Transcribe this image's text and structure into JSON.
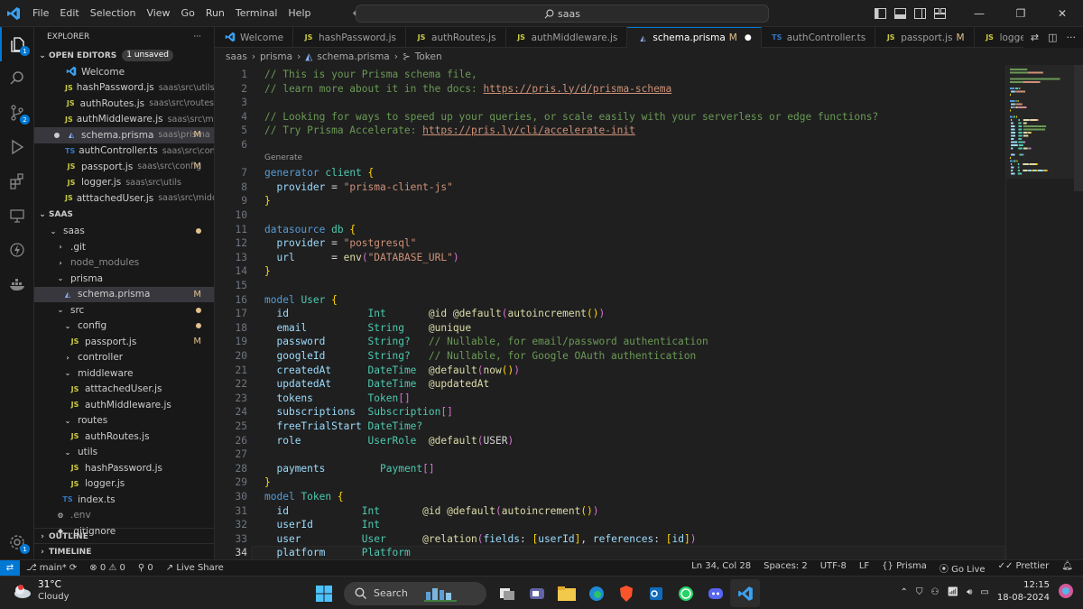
{
  "menu": [
    "File",
    "Edit",
    "Selection",
    "View",
    "Go",
    "Run",
    "Terminal",
    "Help"
  ],
  "search": {
    "label": "saas"
  },
  "activity_badges": {
    "explorer": "1",
    "scm": "2"
  },
  "sidebar": {
    "title": "EXPLORER",
    "open_editors": {
      "label": "OPEN EDITORS",
      "badge": "1 unsaved",
      "items": [
        {
          "icon": "vscode",
          "name": "Welcome",
          "path": "",
          "mark": ""
        },
        {
          "icon": "JS",
          "name": "hashPassword.js",
          "path": "saas\\src\\utils",
          "mark": ""
        },
        {
          "icon": "JS",
          "name": "authRoutes.js",
          "path": "saas\\src\\routes",
          "mark": ""
        },
        {
          "icon": "JS",
          "name": "authMiddleware.js",
          "path": "saas\\src\\midd...",
          "mark": ""
        },
        {
          "icon": "prisma",
          "name": "schema.prisma",
          "path": "saas\\prisma",
          "mark": "M"
        },
        {
          "icon": "TS",
          "name": "authController.ts",
          "path": "saas\\src\\contro...",
          "mark": ""
        },
        {
          "icon": "JS",
          "name": "passport.js",
          "path": "saas\\src\\config",
          "mark": "M"
        },
        {
          "icon": "JS",
          "name": "logger.js",
          "path": "saas\\src\\utils",
          "mark": ""
        },
        {
          "icon": "JS",
          "name": "atttachedUser.js",
          "path": "saas\\src\\middle...",
          "mark": ""
        }
      ]
    },
    "project": {
      "label": "SAAS",
      "tree": [
        {
          "type": "folder",
          "name": "saas",
          "depth": 1,
          "open": true,
          "dot": true
        },
        {
          "type": "folder",
          "name": ".git",
          "depth": 2,
          "open": false
        },
        {
          "type": "folder",
          "name": "node_modules",
          "depth": 2,
          "open": false,
          "dim": true
        },
        {
          "type": "folder",
          "name": "prisma",
          "depth": 2,
          "open": true
        },
        {
          "type": "prisma",
          "name": "schema.prisma",
          "depth": 3,
          "mark": "M",
          "selected": true
        },
        {
          "type": "folder",
          "name": "src",
          "depth": 2,
          "open": true,
          "dot": true
        },
        {
          "type": "folder",
          "name": "config",
          "depth": 3,
          "open": true,
          "dot": true
        },
        {
          "type": "JS",
          "name": "passport.js",
          "depth": 4,
          "mark": "M"
        },
        {
          "type": "folder",
          "name": "controller",
          "depth": 3,
          "open": false
        },
        {
          "type": "folder",
          "name": "middleware",
          "depth": 3,
          "open": true
        },
        {
          "type": "JS",
          "name": "atttachedUser.js",
          "depth": 4
        },
        {
          "type": "JS",
          "name": "authMiddleware.js",
          "depth": 4
        },
        {
          "type": "folder",
          "name": "routes",
          "depth": 3,
          "open": true
        },
        {
          "type": "JS",
          "name": "authRoutes.js",
          "depth": 4
        },
        {
          "type": "folder",
          "name": "utils",
          "depth": 3,
          "open": true
        },
        {
          "type": "JS",
          "name": "hashPassword.js",
          "depth": 4
        },
        {
          "type": "JS",
          "name": "logger.js",
          "depth": 4
        },
        {
          "type": "TS",
          "name": "index.ts",
          "depth": 3
        },
        {
          "type": "gear",
          "name": ".env",
          "depth": 2,
          "dim": true
        },
        {
          "type": "git",
          "name": ".gitignore",
          "depth": 2
        }
      ]
    },
    "outline": "OUTLINE",
    "timeline": "TIMELINE"
  },
  "tabs": [
    {
      "icon": "vscode",
      "label": "Welcome",
      "mark": ""
    },
    {
      "icon": "JS",
      "label": "hashPassword.js",
      "mark": ""
    },
    {
      "icon": "JS",
      "label": "authRoutes.js",
      "mark": ""
    },
    {
      "icon": "JS",
      "label": "authMiddleware.js",
      "mark": ""
    },
    {
      "icon": "prisma",
      "label": "schema.prisma",
      "mark": "M",
      "active": true,
      "dirty": true
    },
    {
      "icon": "TS",
      "label": "authController.ts",
      "mark": ""
    },
    {
      "icon": "JS",
      "label": "passport.js",
      "mark": "M"
    },
    {
      "icon": "JS",
      "label": "logger.js",
      "mark": ""
    }
  ],
  "breadcrumbs": [
    "saas",
    "prisma",
    "schema.prisma",
    "Token"
  ],
  "codelens": "Generate",
  "code": [
    {
      "n": 1,
      "t": [
        [
          "c-com",
          "// This is your Prisma schema file,"
        ]
      ]
    },
    {
      "n": 2,
      "t": [
        [
          "c-com",
          "// learn more about it in the docs: "
        ],
        [
          "c-link",
          "https://pris.ly/d/prisma-schema"
        ]
      ]
    },
    {
      "n": 3,
      "t": []
    },
    {
      "n": 4,
      "t": [
        [
          "c-com",
          "// Looking for ways to speed up your queries, or scale easily with your serverless or edge functions?"
        ]
      ]
    },
    {
      "n": 5,
      "t": [
        [
          "c-com",
          "// Try Prisma Accelerate: "
        ],
        [
          "c-link",
          "https://pris.ly/cli/accelerate-init"
        ]
      ]
    },
    {
      "n": 6,
      "t": []
    },
    {
      "n": 7,
      "t": [
        [
          "c-kw",
          "generator"
        ],
        [
          "c-w",
          " "
        ],
        [
          "c-id",
          "client"
        ],
        [
          "c-w",
          " "
        ],
        [
          "c-br",
          "{"
        ]
      ]
    },
    {
      "n": 8,
      "t": [
        [
          "c-w",
          "  "
        ],
        [
          "c-fld",
          "provider"
        ],
        [
          "c-w",
          " = "
        ],
        [
          "c-str",
          "\"prisma-client-js\""
        ]
      ]
    },
    {
      "n": 9,
      "t": [
        [
          "c-br",
          "}"
        ]
      ]
    },
    {
      "n": 10,
      "t": []
    },
    {
      "n": 11,
      "t": [
        [
          "c-kw",
          "datasource"
        ],
        [
          "c-w",
          " "
        ],
        [
          "c-id",
          "db"
        ],
        [
          "c-w",
          " "
        ],
        [
          "c-br",
          "{"
        ]
      ]
    },
    {
      "n": 12,
      "t": [
        [
          "c-w",
          "  "
        ],
        [
          "c-fld",
          "provider"
        ],
        [
          "c-w",
          " = "
        ],
        [
          "c-str",
          "\"postgresql\""
        ]
      ]
    },
    {
      "n": 13,
      "t": [
        [
          "c-w",
          "  "
        ],
        [
          "c-fld",
          "url"
        ],
        [
          "c-w",
          "      = "
        ],
        [
          "c-attr",
          "env"
        ],
        [
          "c-p",
          "("
        ],
        [
          "c-str",
          "\"DATABASE_URL\""
        ],
        [
          "c-p",
          ")"
        ]
      ]
    },
    {
      "n": 14,
      "t": [
        [
          "c-br",
          "}"
        ]
      ]
    },
    {
      "n": 15,
      "t": []
    },
    {
      "n": 16,
      "t": [
        [
          "c-kw",
          "model"
        ],
        [
          "c-w",
          " "
        ],
        [
          "c-id",
          "User"
        ],
        [
          "c-w",
          " "
        ],
        [
          "c-br",
          "{"
        ]
      ]
    },
    {
      "n": 17,
      "t": [
        [
          "c-w",
          "  "
        ],
        [
          "c-fld",
          "id"
        ],
        [
          "c-w",
          "             "
        ],
        [
          "c-typ",
          "Int"
        ],
        [
          "c-w",
          "       "
        ],
        [
          "c-attr",
          "@id @default"
        ],
        [
          "c-p",
          "("
        ],
        [
          "c-attr",
          "autoincrement"
        ],
        [
          "c-br",
          "()"
        ],
        [
          "c-p",
          ")"
        ]
      ]
    },
    {
      "n": 18,
      "t": [
        [
          "c-w",
          "  "
        ],
        [
          "c-fld",
          "email"
        ],
        [
          "c-w",
          "          "
        ],
        [
          "c-typ",
          "String"
        ],
        [
          "c-w",
          "    "
        ],
        [
          "c-attr",
          "@unique"
        ]
      ]
    },
    {
      "n": 19,
      "t": [
        [
          "c-w",
          "  "
        ],
        [
          "c-fld",
          "password"
        ],
        [
          "c-w",
          "       "
        ],
        [
          "c-typ",
          "String?"
        ],
        [
          "c-w",
          "   "
        ],
        [
          "c-com",
          "// Nullable, for email/password authentication"
        ]
      ]
    },
    {
      "n": 20,
      "t": [
        [
          "c-w",
          "  "
        ],
        [
          "c-fld",
          "googleId"
        ],
        [
          "c-w",
          "       "
        ],
        [
          "c-typ",
          "String?"
        ],
        [
          "c-w",
          "   "
        ],
        [
          "c-com",
          "// Nullable, for Google OAuth authentication"
        ]
      ]
    },
    {
      "n": 21,
      "t": [
        [
          "c-w",
          "  "
        ],
        [
          "c-fld",
          "createdAt"
        ],
        [
          "c-w",
          "      "
        ],
        [
          "c-typ",
          "DateTime"
        ],
        [
          "c-w",
          "  "
        ],
        [
          "c-attr",
          "@default"
        ],
        [
          "c-p",
          "("
        ],
        [
          "c-attr",
          "now"
        ],
        [
          "c-br",
          "()"
        ],
        [
          "c-p",
          ")"
        ]
      ]
    },
    {
      "n": 22,
      "t": [
        [
          "c-w",
          "  "
        ],
        [
          "c-fld",
          "updatedAt"
        ],
        [
          "c-w",
          "      "
        ],
        [
          "c-typ",
          "DateTime"
        ],
        [
          "c-w",
          "  "
        ],
        [
          "c-attr",
          "@updatedAt"
        ]
      ]
    },
    {
      "n": 23,
      "t": [
        [
          "c-w",
          "  "
        ],
        [
          "c-fld",
          "tokens"
        ],
        [
          "c-w",
          "         "
        ],
        [
          "c-typ",
          "Token"
        ],
        [
          "c-p",
          "[]"
        ]
      ]
    },
    {
      "n": 24,
      "t": [
        [
          "c-w",
          "  "
        ],
        [
          "c-fld",
          "subscriptions"
        ],
        [
          "c-w",
          "  "
        ],
        [
          "c-typ",
          "Subscription"
        ],
        [
          "c-p",
          "[]"
        ]
      ]
    },
    {
      "n": 25,
      "t": [
        [
          "c-w",
          "  "
        ],
        [
          "c-fld",
          "freeTrialStart"
        ],
        [
          "c-w",
          " "
        ],
        [
          "c-typ",
          "DateTime?"
        ]
      ]
    },
    {
      "n": 26,
      "t": [
        [
          "c-w",
          "  "
        ],
        [
          "c-fld",
          "role"
        ],
        [
          "c-w",
          "           "
        ],
        [
          "c-typ",
          "UserRole"
        ],
        [
          "c-w",
          "  "
        ],
        [
          "c-attr",
          "@default"
        ],
        [
          "c-p",
          "("
        ],
        [
          "c-w",
          "USER"
        ],
        [
          "c-p",
          ")"
        ]
      ]
    },
    {
      "n": 27,
      "t": []
    },
    {
      "n": 28,
      "t": [
        [
          "c-w",
          "  "
        ],
        [
          "c-fld",
          "payments"
        ],
        [
          "c-w",
          "         "
        ],
        [
          "c-typ",
          "Payment"
        ],
        [
          "c-p",
          "[]"
        ]
      ]
    },
    {
      "n": 29,
      "t": [
        [
          "c-br",
          "}"
        ]
      ]
    },
    {
      "n": 30,
      "t": [
        [
          "c-kw",
          "model"
        ],
        [
          "c-w",
          " "
        ],
        [
          "c-id",
          "Token"
        ],
        [
          "c-w",
          " "
        ],
        [
          "c-br",
          "{"
        ]
      ]
    },
    {
      "n": 31,
      "t": [
        [
          "c-w",
          "  "
        ],
        [
          "c-fld",
          "id"
        ],
        [
          "c-w",
          "            "
        ],
        [
          "c-typ",
          "Int"
        ],
        [
          "c-w",
          "       "
        ],
        [
          "c-attr",
          "@id @default"
        ],
        [
          "c-p",
          "("
        ],
        [
          "c-attr",
          "autoincrement"
        ],
        [
          "c-br",
          "()"
        ],
        [
          "c-p",
          ")"
        ]
      ]
    },
    {
      "n": 32,
      "t": [
        [
          "c-w",
          "  "
        ],
        [
          "c-fld",
          "userId"
        ],
        [
          "c-w",
          "        "
        ],
        [
          "c-typ",
          "Int"
        ]
      ]
    },
    {
      "n": 33,
      "t": [
        [
          "c-w",
          "  "
        ],
        [
          "c-fld",
          "user"
        ],
        [
          "c-w",
          "          "
        ],
        [
          "c-typ",
          "User"
        ],
        [
          "c-w",
          "      "
        ],
        [
          "c-attr",
          "@relation"
        ],
        [
          "c-p",
          "("
        ],
        [
          "c-fld",
          "fields"
        ],
        [
          "c-w",
          ": "
        ],
        [
          "c-br",
          "["
        ],
        [
          "c-fld",
          "userId"
        ],
        [
          "c-br",
          "]"
        ],
        [
          "c-w",
          ", "
        ],
        [
          "c-fld",
          "references"
        ],
        [
          "c-w",
          ": "
        ],
        [
          "c-br",
          "["
        ],
        [
          "c-fld",
          "id"
        ],
        [
          "c-br",
          "]"
        ],
        [
          "c-p",
          ")"
        ]
      ]
    },
    {
      "n": 34,
      "t": [
        [
          "c-w",
          "  "
        ],
        [
          "c-fld",
          "platform"
        ],
        [
          "c-w",
          "      "
        ],
        [
          "c-typ",
          "Platform"
        ]
      ],
      "cur": true
    }
  ],
  "status": {
    "branch": "main*",
    "errors": "0",
    "warnings": "0",
    "ports": "0",
    "liveshare": "Live Share",
    "position": "Ln 34, Col 28",
    "spaces": "Spaces: 2",
    "encoding": "UTF-8",
    "eol": "LF",
    "language": "Prisma",
    "golive": "Go Live",
    "prettier": "Prettier"
  },
  "taskbar": {
    "temp": "31°C",
    "weather": "Cloudy",
    "search": "Search",
    "time": "12:15",
    "date": "18-08-2024"
  }
}
